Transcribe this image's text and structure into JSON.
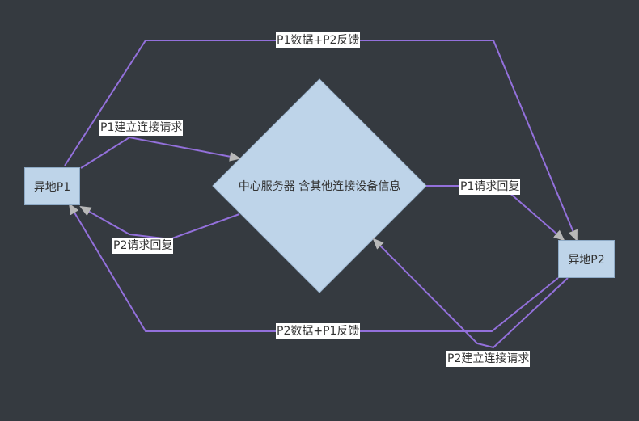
{
  "nodes": {
    "p1": "异地P1",
    "p2": "异地P2",
    "server": "中心服务器 含其他连接设备信息"
  },
  "edges": {
    "p1_to_p2_top": "P1数据+P2反馈",
    "p2_to_p1_bottom": "P2数据+P1反馈",
    "p1_connect_request": "P1建立连接请求",
    "p2_connect_request": "P2建立连接请求",
    "p1_request_reply": "P1请求回复",
    "p2_request_reply": "P2请求回复"
  },
  "colors": {
    "background": "#353a40",
    "edge": "#9370db",
    "node_fill": "#bed4e9",
    "arrowhead": "#b0b0b0"
  }
}
